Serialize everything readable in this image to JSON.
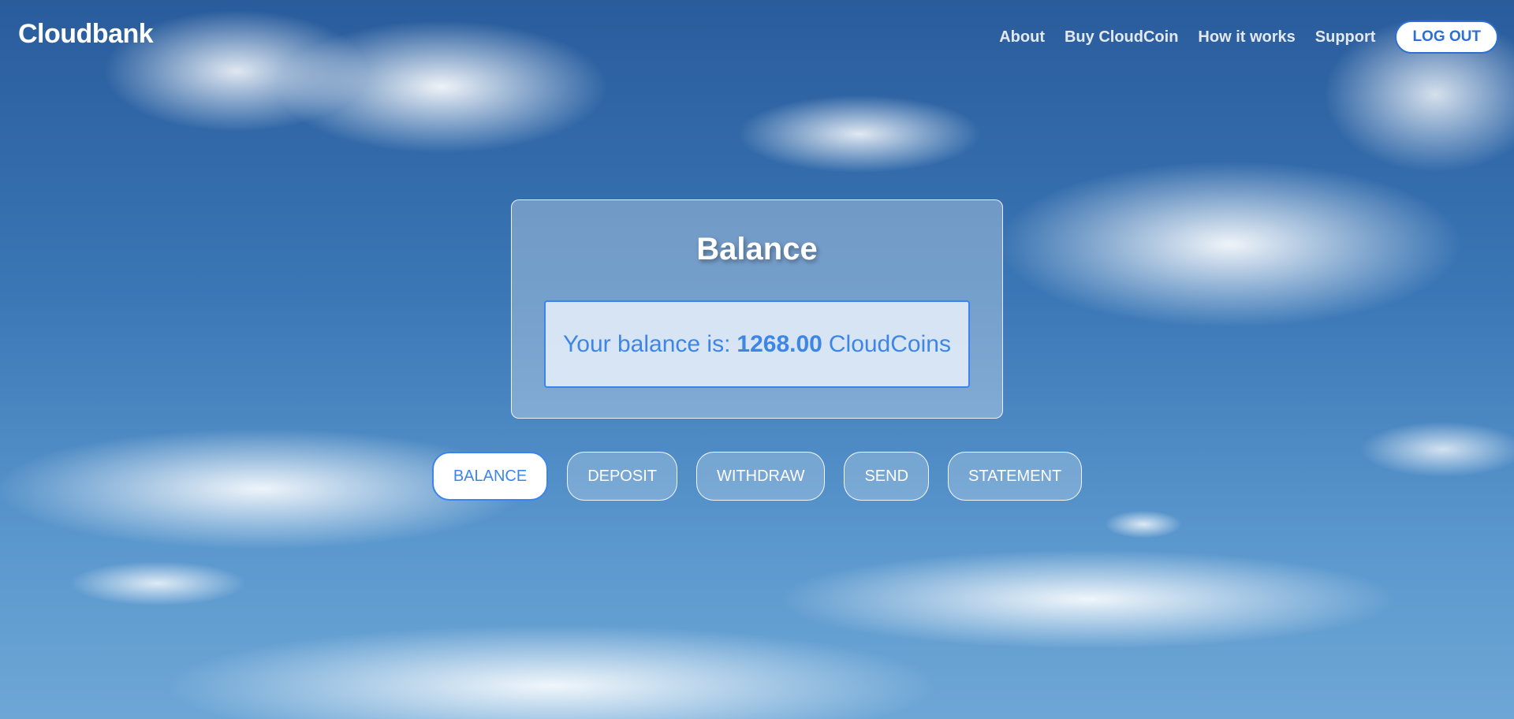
{
  "brand": {
    "name": "Cloudbank"
  },
  "nav": {
    "links": [
      "About",
      "Buy CloudCoin",
      "How it works",
      "Support"
    ],
    "logout_label": "LOG OUT"
  },
  "balance_panel": {
    "title": "Balance",
    "prefix": "Your balance is:",
    "amount": "1268.00",
    "unit": "CloudCoins"
  },
  "actions": {
    "items": [
      "BALANCE",
      "DEPOSIT",
      "WITHDRAW",
      "SEND",
      "STATEMENT"
    ],
    "active": "BALANCE"
  },
  "colors": {
    "accent": "#3b83f0",
    "text_accent": "#3d86e6",
    "sky_top": "#2a5c9c",
    "sky_bottom": "#6ea7d6"
  }
}
